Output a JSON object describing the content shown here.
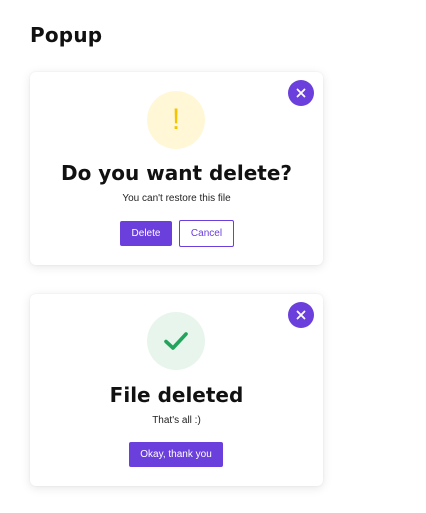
{
  "page": {
    "title": "Popup"
  },
  "colors": {
    "accent": "#6b3fdb",
    "warning": "#f5c400",
    "success": "#22a45d"
  },
  "delete_dialog": {
    "icon": "exclamation-icon",
    "warning_glyph": "!",
    "title": "Do you want delete?",
    "message": "You can't restore this file",
    "confirm_label": "Delete",
    "cancel_label": "Cancel",
    "close_icon": "close-icon"
  },
  "deleted_dialog": {
    "icon": "checkmark-icon",
    "title": "File deleted",
    "message": "That's all :)",
    "confirm_label": "Okay, thank you",
    "close_icon": "close-icon"
  }
}
